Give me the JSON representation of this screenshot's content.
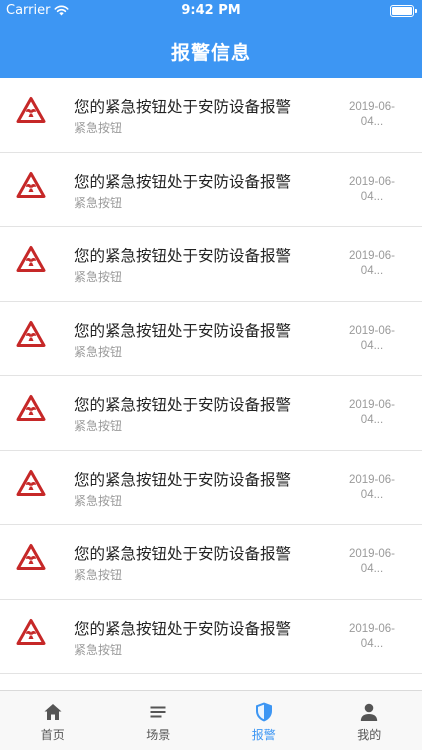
{
  "status_bar": {
    "carrier": "Carrier",
    "time": "9:42 PM",
    "battery_level": 1.0
  },
  "nav": {
    "title": "报警信息"
  },
  "alarms": [
    {
      "title": "您的紧急按钮处于安防设备报警",
      "subtitle": "紧急按钮",
      "date_line1": "2019-06-",
      "date_line2": "04..."
    },
    {
      "title": "您的紧急按钮处于安防设备报警",
      "subtitle": "紧急按钮",
      "date_line1": "2019-06-",
      "date_line2": "04..."
    },
    {
      "title": "您的紧急按钮处于安防设备报警",
      "subtitle": "紧急按钮",
      "date_line1": "2019-06-",
      "date_line2": "04..."
    },
    {
      "title": "您的紧急按钮处于安防设备报警",
      "subtitle": "紧急按钮",
      "date_line1": "2019-06-",
      "date_line2": "04..."
    },
    {
      "title": "您的紧急按钮处于安防设备报警",
      "subtitle": "紧急按钮",
      "date_line1": "2019-06-",
      "date_line2": "04..."
    },
    {
      "title": "您的紧急按钮处于安防设备报警",
      "subtitle": "紧急按钮",
      "date_line1": "2019-06-",
      "date_line2": "04..."
    },
    {
      "title": "您的紧急按钮处于安防设备报警",
      "subtitle": "紧急按钮",
      "date_line1": "2019-06-",
      "date_line2": "04..."
    },
    {
      "title": "您的紧急按钮处于安防设备报警",
      "subtitle": "紧急按钮",
      "date_line1": "2019-06-",
      "date_line2": "04..."
    }
  ],
  "alarm_icon": "hazard-warning-icon",
  "tabs": [
    {
      "label": "首页",
      "icon": "home-icon",
      "active": false
    },
    {
      "label": "场景",
      "icon": "menu-lines-icon",
      "active": false
    },
    {
      "label": "报警",
      "icon": "shield-icon",
      "active": true
    },
    {
      "label": "我的",
      "icon": "person-icon",
      "active": false
    }
  ],
  "colors": {
    "primary": "#3d96f3",
    "alarm_red": "#c62828",
    "text_primary": "#222222",
    "text_secondary": "#9a9a9a"
  }
}
